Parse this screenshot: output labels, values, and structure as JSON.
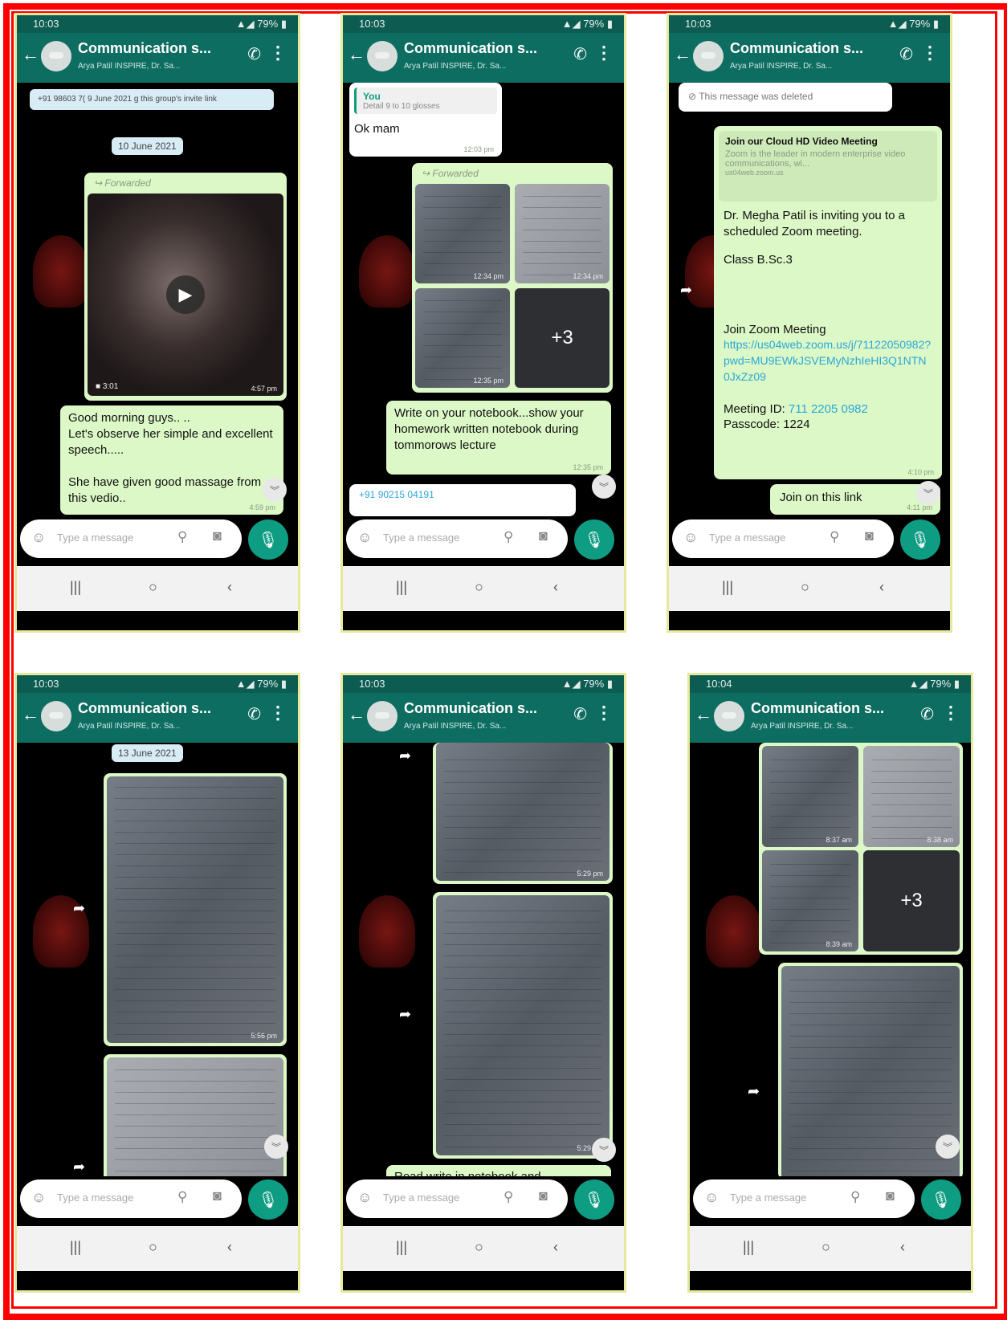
{
  "header": {
    "title": "Communication s...",
    "subtitle": "Arya Patil INSPIRE, Dr. Sa...",
    "input_placeholder": "Type a message",
    "battery": "79%"
  },
  "phones": [
    {
      "time": "10:03",
      "system_note": "+91 98603 7( 9 June 2021  g this group's invite link",
      "date": "10 June 2021",
      "forwarded": "Forwarded",
      "video_duration": "3:01",
      "video_time": "4:57 pm",
      "message": "Good morning guys.. ..\nLet's observe her simple and excellent speech.....\n\nShe have given good massage from this vedio..",
      "message_time": "4:59 pm"
    },
    {
      "time": "10:03",
      "reply_name": "You",
      "reply_text": "Detail 9 to 10 glosses",
      "message_ok": "Ok mam",
      "ok_time": "12:03 pm",
      "forwarded": "Forwarded",
      "img_times": [
        "12:34 pm",
        "12:34 pm",
        "12:35 pm"
      ],
      "plus": "+3",
      "message": "Write on your notebook...show your homework written notebook during tommorows lecture",
      "message_time": "12:35 pm",
      "next_sender": "+91 90215 04191"
    },
    {
      "time": "10:03",
      "deleted": "This message was deleted",
      "link_title": "Join our Cloud HD Video Meeting",
      "link_desc": "Zoom is the leader in modern enterprise video communications, wi...",
      "link_domain": "us04web.zoom.us",
      "invite": "Dr. Megha Patil is inviting you to a scheduled Zoom meeting.",
      "class": "Class B.Sc.3",
      "join_label": "Join Zoom Meeting",
      "join_url": "https://us04web.zoom.us/j/71122050982?pwd=MU9EWkJSVEMyNzhIeHI3Q1NTN0JxZz09",
      "meeting_id_label": "Meeting ID:",
      "meeting_id": "711 2205 0982",
      "passcode": "Passcode: 1224",
      "meeting_time": "4:10 pm",
      "link_message": "Join on this link",
      "link_time": "4:11 pm"
    },
    {
      "time": "10:03",
      "date": "13 June 2021",
      "img_time": "5:56 pm"
    },
    {
      "time": "10:03",
      "img_times": [
        "5:29 pm",
        "5:29 pm"
      ],
      "message": "Read,write in notebook and"
    },
    {
      "time": "10:04",
      "img_times": [
        "8:37 am",
        "8:38 am",
        "8:39 am"
      ],
      "plus": "+3"
    }
  ]
}
